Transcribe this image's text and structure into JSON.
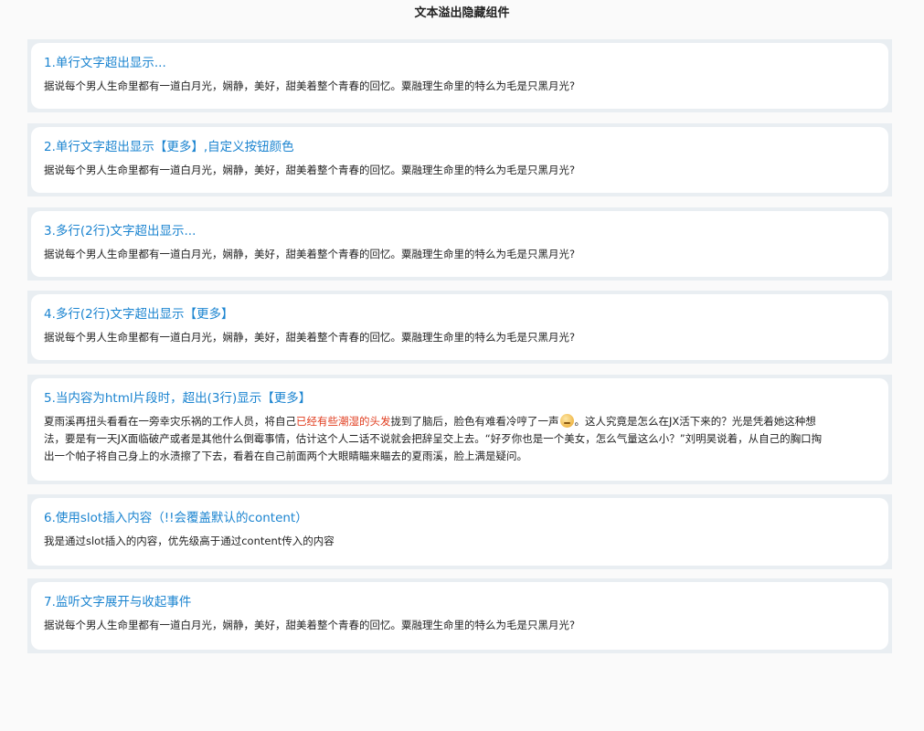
{
  "page_title": "文本溢出隐藏组件",
  "cards": [
    {
      "title": "1.单行文字超出显示...",
      "text": "据说每个男人生命里都有一道白月光，娴静，美好，甜美着整个青春的回忆。粟融理生命里的特么为毛是只黑月光?"
    },
    {
      "title": "2.单行文字超出显示【更多】,自定义按钮颜色",
      "text": "据说每个男人生命里都有一道白月光，娴静，美好，甜美着整个青春的回忆。粟融理生命里的特么为毛是只黑月光?"
    },
    {
      "title": "3.多行(2行)文字超出显示...",
      "text": "据说每个男人生命里都有一道白月光，娴静，美好，甜美着整个青春的回忆。粟融理生命里的特么为毛是只黑月光?"
    },
    {
      "title": "4.多行(2行)文字超出显示【更多】",
      "text": "据说每个男人生命里都有一道白月光，娴静，美好，甜美着整个青春的回忆。粟融理生命里的特么为毛是只黑月光?"
    },
    {
      "title": "5.当内容为html片段时，超出(3行)显示【更多】",
      "text_before": "夏雨溪再扭头看看在一旁幸灾乐祸的工作人员，将自己",
      "text_highlight": "已经有些潮湿的头发",
      "text_middle": "拢到了脑后，脸色有难看冷哼了一声",
      "text_after": "。这人究竟是怎么在JX活下来的？光是凭着她这种想法，要是有一天JX面临破产或者是其他什么倒霉事情，估计这个人二话不说就会把辞呈交上去。“好歹你也是一个美女，怎么气量这么小？”刘明昊说着，从自己的胸口掏出一个帕子将自己身上的水渍擦了下去，看着在自己前面两个大眼睛瞄来瞄去的夏雨溪，脸上满是疑问。",
      "highlight_color": "#e03c1e",
      "emoji_icon": "face-emoji-icon"
    },
    {
      "title": "6.使用slot插入内容（!!会覆盖默认的content）",
      "text": "我是通过slot插入的内容，优先级高于通过content传入的内容"
    },
    {
      "title": "7.监听文字展开与收起事件",
      "text": "据说每个男人生命里都有一道白月光，娴静，美好，甜美着整个青春的回忆。粟融理生命里的特么为毛是只黑月光?"
    }
  ],
  "colors": {
    "title_blue": "#1b84d0",
    "card_border": "#e9eef2",
    "highlight_red": "#e03c1e"
  }
}
